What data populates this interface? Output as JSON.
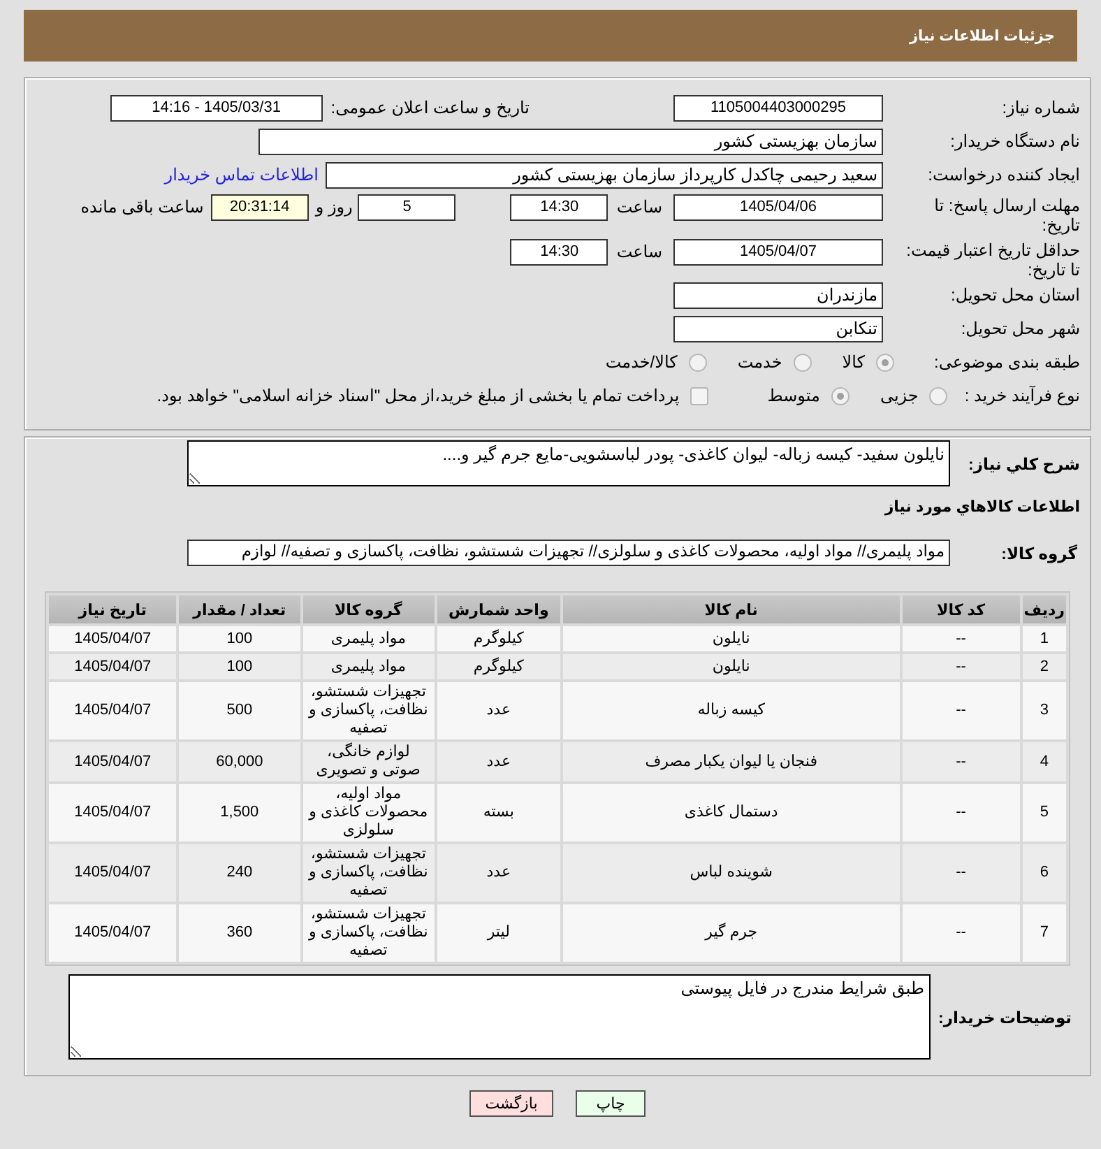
{
  "header": {
    "title": "جزئیات اطلاعات نیاز"
  },
  "details": {
    "need_number": {
      "label": "شماره نیاز:",
      "value": "1105004403000295"
    },
    "announce_date": {
      "label": "تاریخ و ساعت اعلان عمومی:",
      "value": "1405/03/31 - 14:16"
    },
    "buyer_org": {
      "label": "نام دستگاه خریدار:",
      "value": "سازمان بهزیستی کشور"
    },
    "requester": {
      "label": "ایجاد کننده درخواست:",
      "value": "سعید رحیمی چاکدل کارپرداز سازمان بهزیستی کشور",
      "contact_link": "اطلاعات تماس خریدار"
    },
    "response_deadline": {
      "label": "مهلت ارسال پاسخ: تا تاریخ:",
      "date": "1405/04/06",
      "time_label": "ساعت",
      "time": "14:30",
      "days": "5",
      "days_label": "روز و",
      "remaining": "20:31:14",
      "remaining_label": "ساعت باقی مانده"
    },
    "price_validity": {
      "label": "حداقل تاریخ اعتبار قیمت: تا تاریخ:",
      "date": "1405/04/07",
      "time_label": "ساعت",
      "time": "14:30"
    },
    "province": {
      "label": "استان محل تحویل:",
      "value": "مازندران"
    },
    "city": {
      "label": "شهر محل تحویل:",
      "value": "تنکابن"
    },
    "category": {
      "label": "طبقه بندی موضوعی:",
      "options": [
        {
          "label": "کالا",
          "selected": true
        },
        {
          "label": "خدمت",
          "selected": false
        },
        {
          "label": "کالا/خدمت",
          "selected": false
        }
      ]
    },
    "purchase_type": {
      "label": "نوع فرآیند خرید :",
      "options": [
        {
          "label": "جزیی",
          "selected": false
        },
        {
          "label": "متوسط",
          "selected": true
        }
      ],
      "treasury": {
        "label": "پرداخت تمام یا بخشی از مبلغ خرید،از محل \"اسناد خزانه اسلامی\" خواهد بود.",
        "checked": false
      }
    }
  },
  "needs": {
    "summary_label": "شرح كلي نياز:",
    "summary": "نایلون سفید- کیسه زباله- لیوان کاغذی- پودر لباسشویی-مایع جرم گیر و....",
    "section_title": "اطلاعات كالاهاي مورد نياز",
    "group_label": "گروه کالا:",
    "group": "مواد پلیمری// مواد اولیه، محصولات کاغذی و سلولزی// تجهیزات شستشو، نظافت، پاکسازی و تصفیه// لوازم"
  },
  "table": {
    "columns": [
      "ردیف",
      "کد کالا",
      "نام کالا",
      "واحد شمارش",
      "گروه کالا",
      "تعداد / مقدار",
      "تاریخ نیاز"
    ],
    "rows": [
      [
        "1",
        "--",
        "نایلون",
        "کیلوگرم",
        "مواد پلیمری",
        "100",
        "1405/04/07"
      ],
      [
        "2",
        "--",
        "نایلون",
        "کیلوگرم",
        "مواد پلیمری",
        "100",
        "1405/04/07"
      ],
      [
        "3",
        "--",
        "کیسه زباله",
        "عدد",
        "تجهیزات شستشو، نظافت، پاکسازی و تصفیه",
        "500",
        "1405/04/07"
      ],
      [
        "4",
        "--",
        "فنجان یا لیوان یکبار مصرف",
        "عدد",
        "لوازم خانگی، صوتی و تصویری",
        "60,000",
        "1405/04/07"
      ],
      [
        "5",
        "--",
        "دستمال کاغذی",
        "بسته",
        "مواد اولیه، محصولات کاغذی و سلولزی",
        "1,500",
        "1405/04/07"
      ],
      [
        "6",
        "--",
        "شوینده لباس",
        "عدد",
        "تجهیزات شستشو، نظافت، پاکسازی و تصفیه",
        "240",
        "1405/04/07"
      ],
      [
        "7",
        "--",
        "جرم گیر",
        "لیتر",
        "تجهیزات شستشو، نظافت، پاکسازی و تصفیه",
        "360",
        "1405/04/07"
      ]
    ]
  },
  "buyer_notes": {
    "label": "توضیحات خریدار:",
    "value": "طبق شرایط مندرج در فایل پیوستی"
  },
  "buttons": [
    {
      "label": "چاپ",
      "kind": "print"
    },
    {
      "label": "بازگشت",
      "kind": "back"
    }
  ]
}
